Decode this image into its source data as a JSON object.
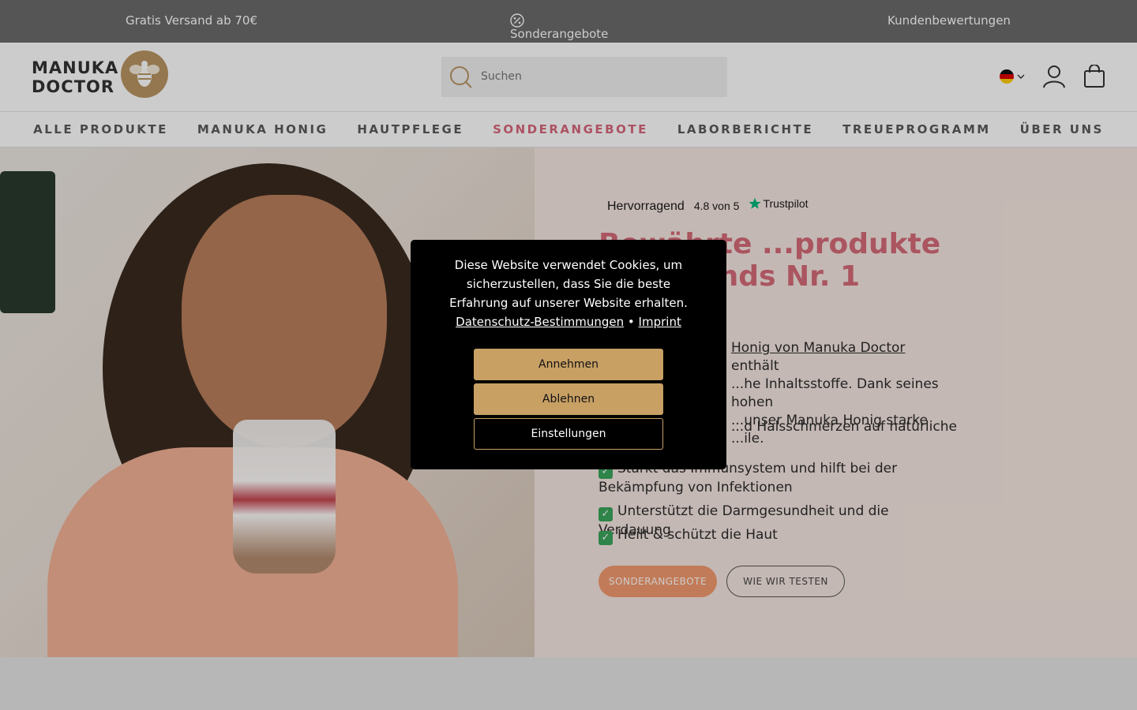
{
  "topbar": {
    "free_shipping": "Gratis Versand ab 70€",
    "special_offers": "Sonderangebote",
    "reviews": "Kundenbewertungen"
  },
  "header": {
    "logo_line1": "MANUKA",
    "logo_line2": "DOCTOR",
    "search_placeholder": "Suchen"
  },
  "nav": {
    "items": [
      {
        "label": "ALLE PRODUKTE"
      },
      {
        "label": "MANUKA HONIG"
      },
      {
        "label": "HAUTPFLEGE"
      },
      {
        "label": "SONDERANGEBOTE"
      },
      {
        "label": "LABORBERICHTE"
      },
      {
        "label": "TREUEPROGRAMM"
      },
      {
        "label": "ÜBER UNS"
      }
    ],
    "active_color": "#d9677c"
  },
  "hero": {
    "trust_rating_word": "Hervorragend",
    "trust_score": "4.8 von 5",
    "trust_brand": "Trustpilot",
    "title": "Bewährte ...produkte von ...ands Nr. 1",
    "text_link": "Honig von Manuka Doctor",
    "text_after_link": "enthält",
    "text_line2": "...he Inhaltsstoffe. Dank seines hohen",
    "text_line3": "...unser Manuka Honig starke",
    "text_line4": "...ile.",
    "bullet1": "...d Halsschmerzen auf natürliche",
    "bullet2": "Stärkt das Immunsystem und hilft bei der Bekämpfung von Infektionen",
    "bullet3": "Unterstützt die Darmgesundheit und die Verdauung",
    "bullet4": "Heilt & schützt die Haut",
    "btn_primary": "SONDERANGEBOTE",
    "btn_secondary": "WIE WIR TESTEN",
    "accent": "#f39a6f"
  },
  "cookie": {
    "message": "Diese Website verwendet Cookies, um sicherzustellen, dass Sie die beste Erfahrung auf unserer Website erhalten.",
    "privacy_link": "Datenschutz-Bestimmungen",
    "separator": "•",
    "imprint_link": "Imprint",
    "accept": "Annehmen",
    "decline": "Ablehnen",
    "settings": "Einstellungen",
    "button_color": "#c8a064"
  }
}
